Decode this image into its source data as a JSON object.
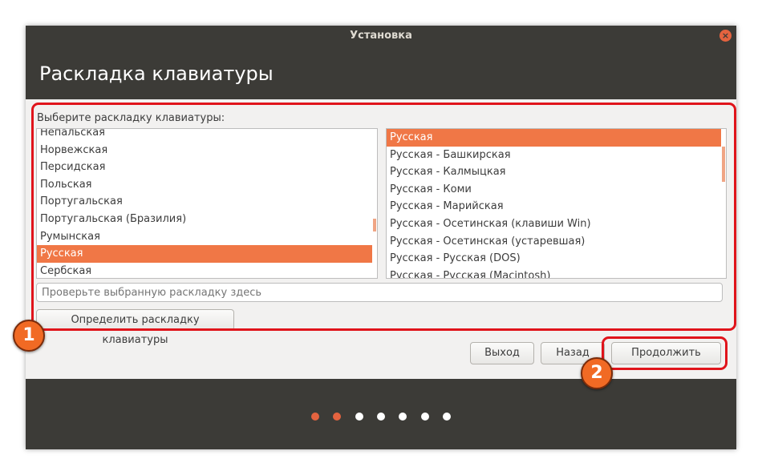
{
  "window": {
    "title": "Установка"
  },
  "header": {
    "title": "Раскладка клавиатуры"
  },
  "layout": {
    "label": "Выберите раскладку клавиатуры:",
    "languages": [
      "Непальская",
      "Норвежская",
      "Персидская",
      "Польская",
      "Португальская",
      "Португальская (Бразилия)",
      "Румынская",
      "Русская",
      "Сербская"
    ],
    "selected_language": "Русская",
    "variants": [
      "Русская",
      "Русская - Башкирская",
      "Русская - Калмыцкая",
      "Русская - Коми",
      "Русская - Марийская",
      "Русская - Осетинская (клавиши Win)",
      "Русская - Осетинская (устаревшая)",
      "Русская - Русская (DOS)",
      "Русская - Русская (Macintosh)"
    ],
    "selected_variant": "Русская",
    "test_placeholder": "Проверьте выбранную раскладку здесь",
    "detect_label": "Определить раскладку клавиатуры"
  },
  "buttons": {
    "quit": "Выход",
    "back": "Назад",
    "continue": "Продолжить"
  },
  "progress": {
    "total_steps": 7,
    "active_steps": 2
  },
  "annotations": {
    "marker_1": "1",
    "marker_2": "2"
  },
  "colors": {
    "accent": "#f07746",
    "titlebar": "#3c3b37",
    "highlight": "#e0141b",
    "marker": "#f16a24"
  }
}
